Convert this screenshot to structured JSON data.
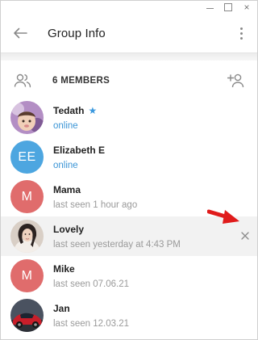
{
  "window": {
    "controls": [
      "minimize",
      "maximize",
      "close"
    ],
    "close_glyph": "×"
  },
  "header": {
    "title": "Group Info",
    "back_icon": "arrow-left-icon",
    "menu_icon": "more-vertical-icon"
  },
  "members_bar": {
    "label": "6 MEMBERS",
    "icon": "people-icon",
    "add_icon": "add-person-icon"
  },
  "members": [
    {
      "name": "Tedath",
      "status": "online",
      "online": true,
      "starred": true,
      "avatar_type": "photo",
      "avatar_color": "#9b6fb0"
    },
    {
      "name": "Elizabeth E",
      "status": "online",
      "online": true,
      "starred": false,
      "avatar_type": "initials",
      "initials": "EE",
      "avatar_color": "#4da6e0"
    },
    {
      "name": "Mama",
      "status": "last seen 1 hour ago",
      "online": false,
      "starred": false,
      "avatar_type": "initials",
      "initials": "M",
      "avatar_color": "#e06c6c"
    },
    {
      "name": "Lovely",
      "status": "last seen yesterday at 4:43 PM",
      "online": false,
      "starred": false,
      "avatar_type": "photo",
      "avatar_color": "#c9b8a8",
      "highlighted": true
    },
    {
      "name": "Mike",
      "status": "last seen 07.06.21",
      "online": false,
      "starred": false,
      "avatar_type": "initials",
      "initials": "M",
      "avatar_color": "#e06c6c"
    },
    {
      "name": "Jan",
      "status": "last seen 12.03.21",
      "online": false,
      "starred": false,
      "avatar_type": "photo",
      "avatar_color": "#3a3f4a"
    }
  ],
  "colors": {
    "accent": "#3b95d6",
    "muted_text": "#9a9a9a",
    "highlight_row": "#f2f2f2",
    "annotation_arrow": "#e01b1b"
  },
  "star_glyph": "★",
  "remove_icon": "close-icon"
}
